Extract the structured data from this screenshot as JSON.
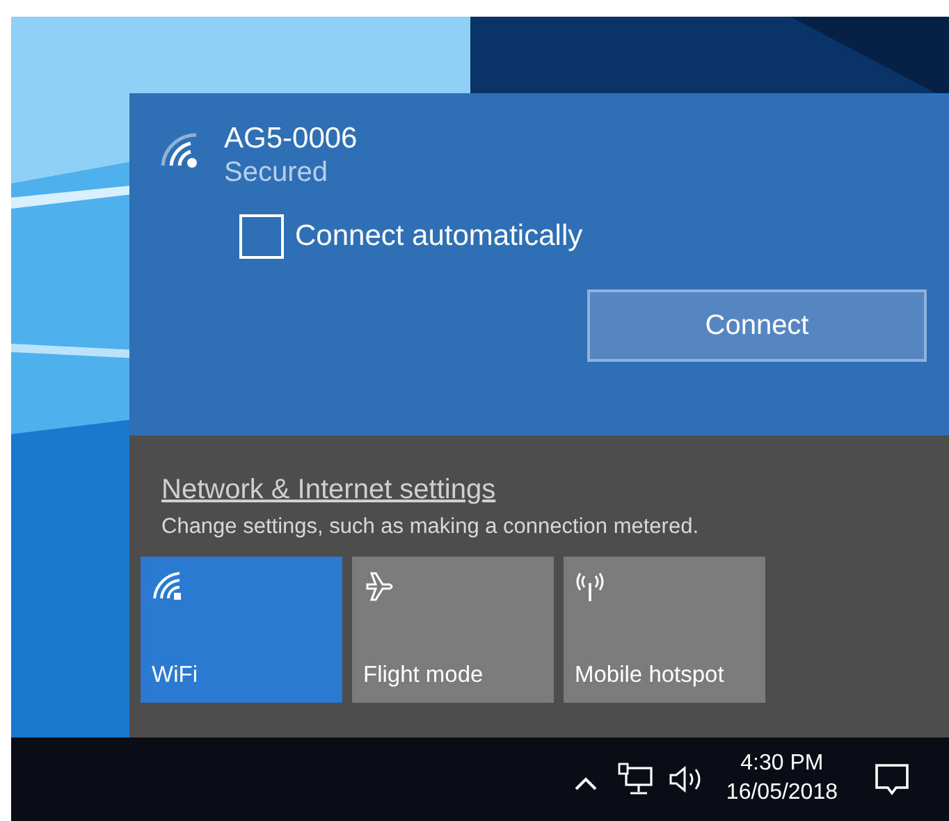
{
  "network": {
    "ssid": "AG5-0006",
    "status": "Secured",
    "auto_connect": {
      "label": "Connect automatically",
      "checked": false
    },
    "connect_button": "Connect"
  },
  "settings": {
    "link": "Network & Internet settings",
    "description": "Change settings, such as making a connection metered."
  },
  "quick_actions": [
    {
      "label": "WiFi",
      "kind": "wifi",
      "selected": true
    },
    {
      "label": "Flight mode",
      "kind": "flight",
      "selected": false
    },
    {
      "label": "Mobile hotspot",
      "kind": "hotspot",
      "selected": false
    }
  ],
  "taskbar": {
    "time": "4:30 PM",
    "date": "16/05/2018"
  }
}
